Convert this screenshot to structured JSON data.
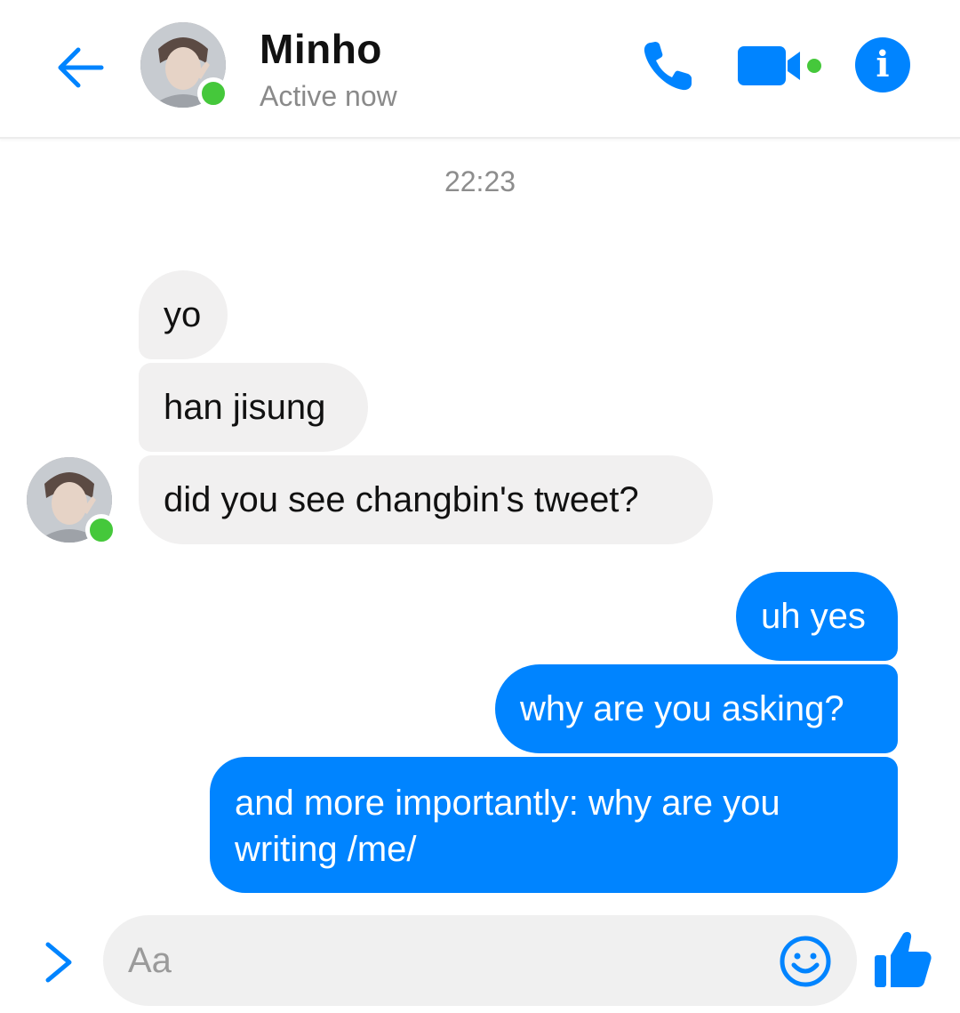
{
  "header": {
    "contact_name": "Minho",
    "status": "Active now",
    "back_icon": "arrow-left-icon",
    "call_icon": "phone-icon",
    "video_icon": "video-camera-icon",
    "info_label": "i"
  },
  "conversation": {
    "timestamp": "22:23",
    "messages": [
      {
        "direction": "incoming",
        "text": "yo"
      },
      {
        "direction": "incoming",
        "text": "han jisung"
      },
      {
        "direction": "incoming",
        "text": "did you see changbin's tweet?"
      },
      {
        "direction": "outgoing",
        "text": "uh yes"
      },
      {
        "direction": "outgoing",
        "text": "why are you asking?"
      },
      {
        "direction": "outgoing",
        "text": "and more importantly: why are you writing /me/"
      }
    ]
  },
  "composer": {
    "placeholder": "Aa",
    "value": "",
    "expand_icon": "chevron-right-icon",
    "emoji_icon": "smiley-icon",
    "like_icon": "thumbs-up-icon"
  },
  "colors": {
    "accent": "#0084ff",
    "incoming_bubble": "#f1f0f0",
    "online": "#45c83b",
    "muted_text": "#8a8a8a"
  }
}
